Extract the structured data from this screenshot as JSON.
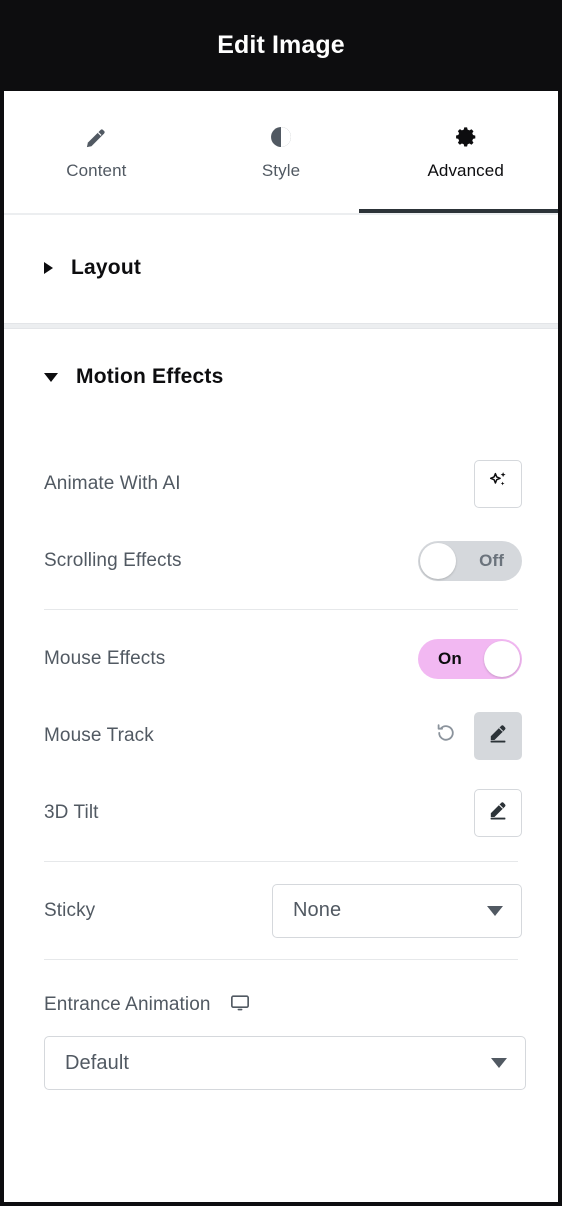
{
  "window": {
    "title": "Edit Image"
  },
  "tabs": [
    {
      "label": "Content",
      "icon": "pencil-icon",
      "active": false
    },
    {
      "label": "Style",
      "icon": "contrast-icon",
      "active": false
    },
    {
      "label": "Advanced",
      "icon": "gear-icon",
      "active": true
    }
  ],
  "sections": [
    {
      "id": "layout",
      "title": "Layout",
      "expanded": false,
      "caret": "caret-right-icon"
    },
    {
      "id": "motion_effects",
      "title": "Motion Effects",
      "expanded": true,
      "caret": "caret-down-icon"
    }
  ],
  "controls": {
    "animate_with_ai": {
      "label": "Animate With AI",
      "button_icon": "ai-sparkle-icon"
    },
    "scrolling_effects": {
      "label": "Scrolling Effects",
      "state": "Off"
    },
    "mouse_effects": {
      "label": "Mouse Effects",
      "state": "On"
    },
    "mouse_track": {
      "label": "Mouse Track",
      "reset_icon": "reset-icon",
      "edit_icon": "pencil-icon"
    },
    "tilt_3d": {
      "label": "3D Tilt",
      "edit_icon": "pencil-icon"
    },
    "sticky": {
      "label": "Sticky",
      "value": "None"
    },
    "entrance_animation": {
      "label": "Entrance Animation",
      "device_icon": "desktop-icon",
      "value": "Default"
    }
  },
  "colors": {
    "titlebar_bg": "#0d0d0f",
    "panel_bg": "#ffffff",
    "label_text": "#515962",
    "heading_text": "#0d0d0f",
    "toggle_on": "#f2b8f2",
    "toggle_off": "#d5d8dc",
    "active_tab_underline": "#2c3338",
    "border": "#d5d8dc",
    "divider": "#e6e8ea"
  }
}
